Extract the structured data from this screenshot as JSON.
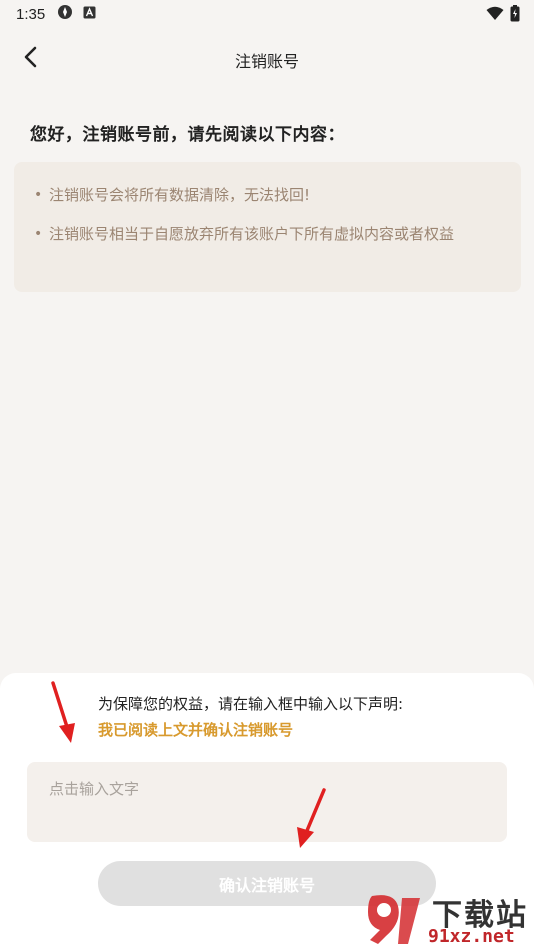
{
  "status_bar": {
    "time": "1:35",
    "left_icons": [
      "settings-icon",
      "a-badge-icon"
    ],
    "right_icons": [
      "wifi-icon",
      "battery-icon"
    ]
  },
  "header": {
    "title": "注销账号",
    "back_icon": "chevron-left-icon"
  },
  "main": {
    "intro": "您好，注销账号前，请先阅读以下内容：",
    "notices": [
      {
        "bullet": "•",
        "text": "注销账号会将所有数据清除，无法找回!"
      },
      {
        "bullet": "•",
        "text": "注销账号相当于自愿放弃所有该账户下所有虚拟内容或者权益"
      }
    ]
  },
  "sheet": {
    "declare_label": "为保障您的权益，请在输入框中输入以下声明:",
    "declare_text": "我已阅读上文并确认注销账号",
    "input_placeholder": "点击输入文字",
    "input_value": "",
    "confirm_label": "确认注销账号"
  },
  "watermark": {
    "main": "下载站",
    "sub": "91xz.net"
  },
  "colors": {
    "background": "#f6f4f2",
    "card": "#f1ece6",
    "notice_text": "#9b8572",
    "accent": "#d89a2e",
    "button_disabled": "#e0e0e0",
    "annotation_arrow": "#e02020"
  }
}
